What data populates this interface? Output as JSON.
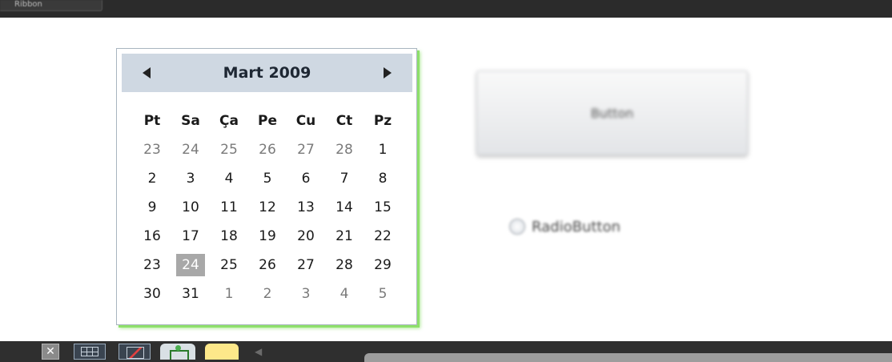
{
  "window": {
    "top_tab_label": "Ribbon"
  },
  "calendar": {
    "month_title": "Mart 2009",
    "weekdays": [
      "Pt",
      "Sa",
      "Ça",
      "Pe",
      "Cu",
      "Ct",
      "Pz"
    ],
    "weeks": [
      [
        {
          "d": "23",
          "other": true
        },
        {
          "d": "24",
          "other": true
        },
        {
          "d": "25",
          "other": true
        },
        {
          "d": "26",
          "other": true
        },
        {
          "d": "27",
          "other": true
        },
        {
          "d": "28",
          "other": true
        },
        {
          "d": "1",
          "other": false
        }
      ],
      [
        {
          "d": "2",
          "other": false
        },
        {
          "d": "3",
          "other": false
        },
        {
          "d": "4",
          "other": false
        },
        {
          "d": "5",
          "other": false
        },
        {
          "d": "6",
          "other": false
        },
        {
          "d": "7",
          "other": false
        },
        {
          "d": "8",
          "other": false
        }
      ],
      [
        {
          "d": "9",
          "other": false
        },
        {
          "d": "10",
          "other": false
        },
        {
          "d": "11",
          "other": false
        },
        {
          "d": "12",
          "other": false
        },
        {
          "d": "13",
          "other": false
        },
        {
          "d": "14",
          "other": false
        },
        {
          "d": "15",
          "other": false
        }
      ],
      [
        {
          "d": "16",
          "other": false
        },
        {
          "d": "17",
          "other": false
        },
        {
          "d": "18",
          "other": false
        },
        {
          "d": "19",
          "other": false
        },
        {
          "d": "20",
          "other": false
        },
        {
          "d": "21",
          "other": false
        },
        {
          "d": "22",
          "other": false
        }
      ],
      [
        {
          "d": "23",
          "other": false
        },
        {
          "d": "24",
          "other": false,
          "selected": true
        },
        {
          "d": "25",
          "other": false
        },
        {
          "d": "26",
          "other": false
        },
        {
          "d": "27",
          "other": false
        },
        {
          "d": "28",
          "other": false
        },
        {
          "d": "29",
          "other": false
        }
      ],
      [
        {
          "d": "30",
          "other": false
        },
        {
          "d": "31",
          "other": false
        },
        {
          "d": "1",
          "other": true
        },
        {
          "d": "2",
          "other": true
        },
        {
          "d": "3",
          "other": true
        },
        {
          "d": "4",
          "other": true
        },
        {
          "d": "5",
          "other": true
        }
      ]
    ],
    "colors": {
      "header_bg": "#cfd8e2",
      "selected_bg": "#a8a8a8",
      "glow": "#8ee06a"
    }
  },
  "button": {
    "label": "Button"
  },
  "radio": {
    "label": "RadioButton",
    "checked": false
  },
  "taskbar": {
    "close_glyph": "✕",
    "back_glyph": "◀",
    "icons": [
      "close-icon",
      "grid-icon",
      "chart-icon",
      "snapshot-icon",
      "note-icon"
    ]
  }
}
